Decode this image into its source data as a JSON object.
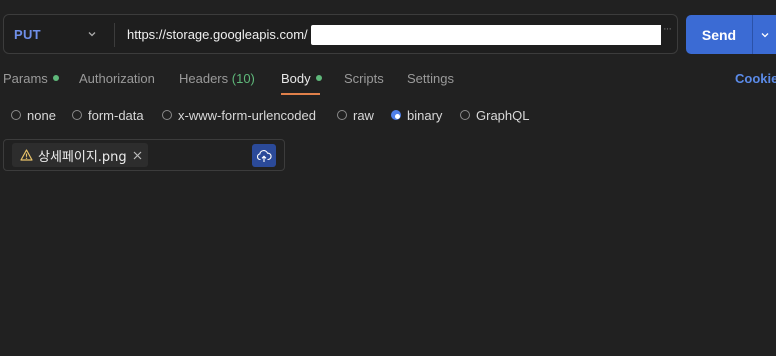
{
  "request": {
    "method": "PUT",
    "url": "https://storage.googleapis.com/",
    "send_label": "Send"
  },
  "tabs": [
    {
      "label": "Params",
      "has_dot": true
    },
    {
      "label": "Authorization"
    },
    {
      "label": "Headers",
      "count": "(10)"
    },
    {
      "label": "Body",
      "has_dot": true,
      "active": true
    },
    {
      "label": "Scripts"
    },
    {
      "label": "Settings"
    }
  ],
  "cookies_label": "Cookie",
  "body_types": [
    {
      "label": "none",
      "checked": false
    },
    {
      "label": "form-data",
      "checked": false
    },
    {
      "label": "x-www-form-urlencoded",
      "checked": false
    },
    {
      "label": "raw",
      "checked": false
    },
    {
      "label": "binary",
      "checked": true
    },
    {
      "label": "GraphQL",
      "checked": false
    }
  ],
  "file": {
    "name": "상세페이지.png",
    "icon": "warning-icon"
  },
  "colors": {
    "accent": "#3b6bd4",
    "method": "#6f8fe8",
    "active_dot": "#5fb87a",
    "tab_underline": "#e0804a"
  }
}
